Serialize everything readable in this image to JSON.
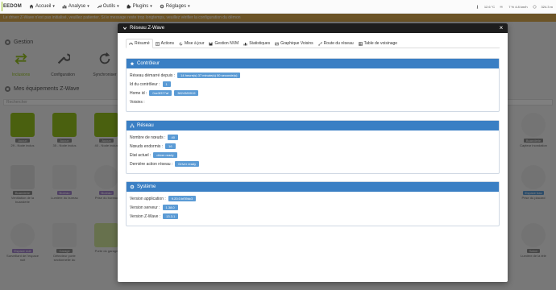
{
  "navbar": {
    "logo_text": "EEDOM",
    "menu": [
      {
        "label": "Accueil",
        "icon": "home-icon"
      },
      {
        "label": "Analyse",
        "icon": "chart-icon"
      },
      {
        "label": "Outils",
        "icon": "wrench-icon"
      },
      {
        "label": "Plugins",
        "icon": "puzzle-icon"
      },
      {
        "label": "Réglages",
        "icon": "gear-icon"
      }
    ],
    "status": [
      "12.6 °C",
      "7 % 4.8 km/h",
      "324.3 m"
    ]
  },
  "alert": {
    "text": "Le driver Z-Wave n'est pas initialisé, veuillez patienter. Si le message reste trop longtemps, veuillez vérifier la configuration du démon"
  },
  "background": {
    "gestion_title": "Gestion",
    "tools": [
      {
        "label": "Inclusions"
      },
      {
        "label": "Configuration"
      },
      {
        "label": "Synchroniser"
      }
    ],
    "equipments_title": "Mes équipements Z-Wave",
    "search_placeholder": "Rechercher",
    "cards": [
      {
        "tag": "Aucun",
        "name": "29 - Node inclus"
      },
      {
        "tag": "Aucun",
        "name": "35 - Node inclus"
      },
      {
        "tag": "Aucun",
        "name": "40 - Node inclus"
      },
      {
        "tag": "Buanderie",
        "name": "Capteur inondation"
      },
      {
        "tag": "Buanderie",
        "name": "Ventilation de la buanderie"
      },
      {
        "tag": "Bureau",
        "name": "Lumière du bureau"
      },
      {
        "tag": "Bureau",
        "name": "Prise du bureau"
      },
      {
        "tag": "Espace bas",
        "name": "Prise du placard"
      },
      {
        "tag": "Espace nuit",
        "name": "Surveillant de l'espace nuit"
      },
      {
        "tag": "Garage",
        "name": "Détecteur porte sectionnelle du"
      },
      {
        "tag": "",
        "name": "Porte du garage"
      },
      {
        "tag": "Salon",
        "name": "Lumière de la télé"
      }
    ]
  },
  "modal": {
    "title": "Réseau Z-Wave",
    "close": "×",
    "tabs": [
      {
        "label": "Résumé",
        "icon": "tachometer-icon"
      },
      {
        "label": "Actions",
        "icon": "list-icon"
      },
      {
        "label": "Mise à jour",
        "icon": "refresh-icon"
      },
      {
        "label": "Gestion NVM",
        "icon": "save-icon"
      },
      {
        "label": "Statistiques",
        "icon": "bar-chart-icon"
      },
      {
        "label": "Graphique Voisins",
        "icon": "image-icon"
      },
      {
        "label": "Route du réseau",
        "icon": "route-icon"
      },
      {
        "label": "Table de voisinage",
        "icon": "table-icon"
      }
    ],
    "controleur": {
      "title": "Contrôleur",
      "reseau_label": "Réseau démarré depuis :",
      "reseau_value": "14 heure(s) 37 minute(s) 50 seconde(s)",
      "id_label": "Id du contrôleur :",
      "id_value": "1",
      "home_label": "Home id :",
      "home_value_1": "0xe3f377af",
      "home_value_2": "3824383919",
      "voisins_label": "Voisins :"
    },
    "reseau": {
      "title": "Réseau",
      "noeuds_label": "Nombre de nœuds :",
      "noeuds_value": "40",
      "endormis_label": "Nœuds endormis :",
      "endormis_value": "16",
      "etat_label": "Etat actuel :",
      "etat_value": "driver ready",
      "action_label": "Dernière action réseau :",
      "action_value": "Driver ready"
    },
    "systeme": {
      "title": "Système",
      "app_label": "Version application :",
      "app_value": "9.20.0.bf39dc3",
      "serveur_label": "Version serveur :",
      "serveur_value": "1.38.0",
      "zwave_label": "Version Z-Wave :",
      "zwave_value": "13.3.1"
    }
  }
}
